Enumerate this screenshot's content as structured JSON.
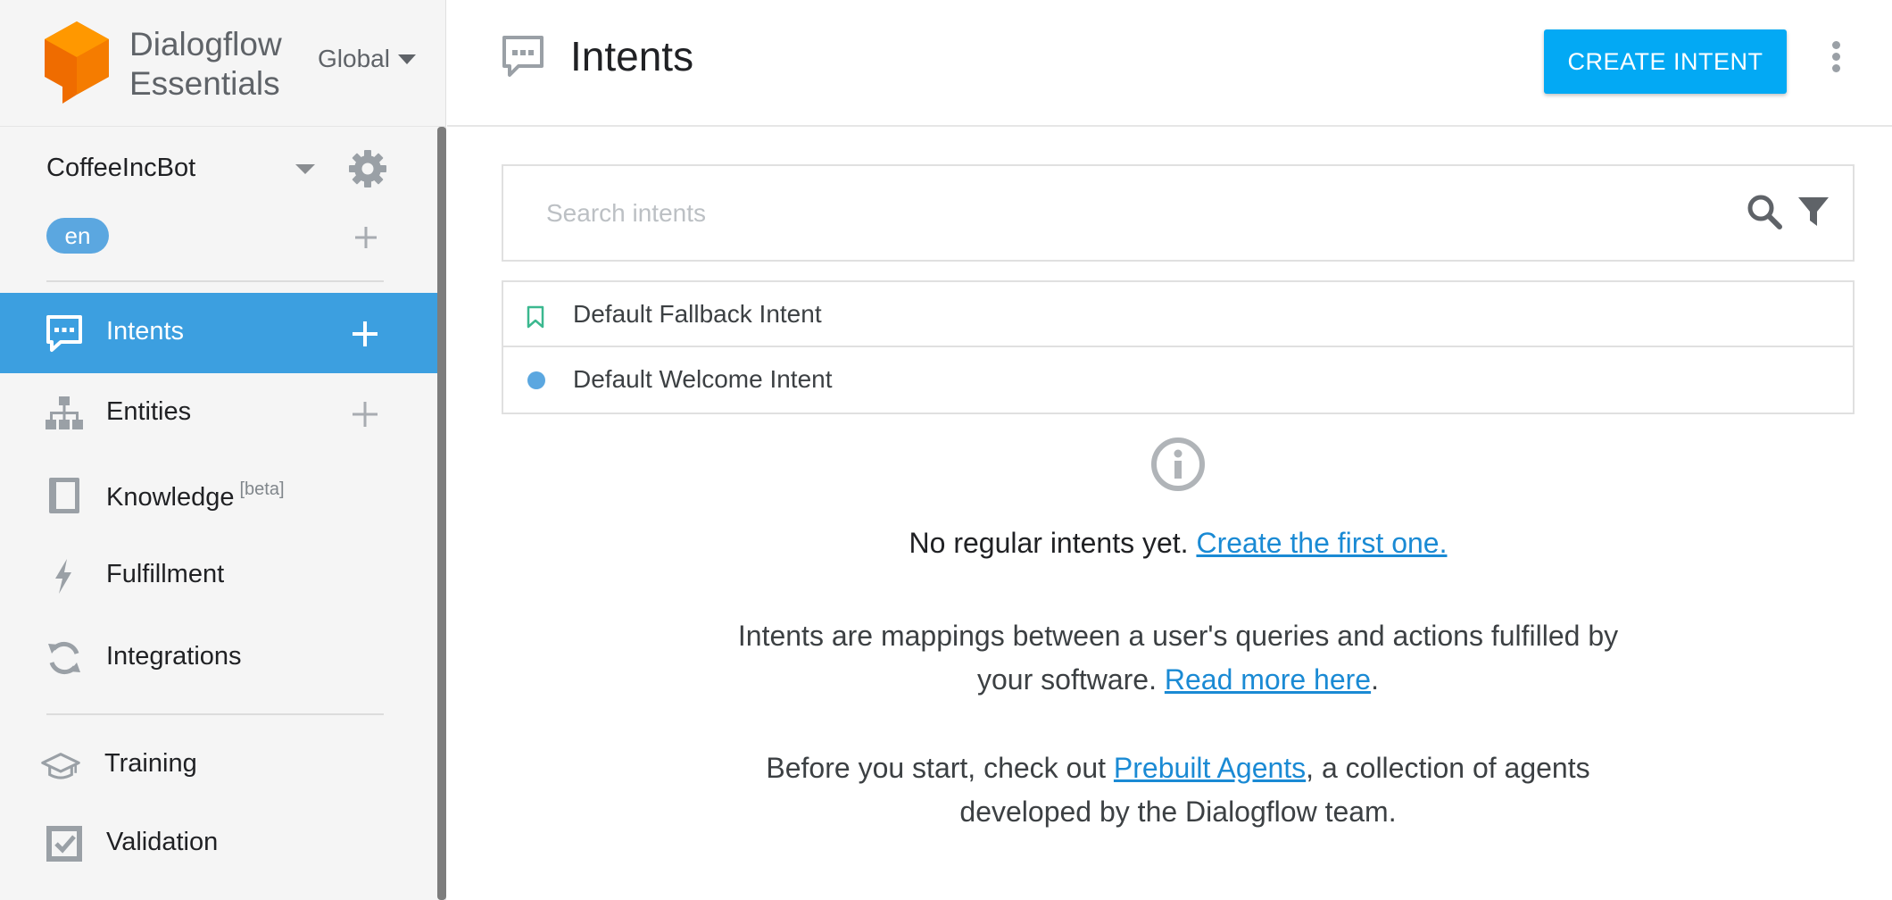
{
  "brand": {
    "name_line1": "Dialogflow",
    "name_line2": "Essentials",
    "region": "Global"
  },
  "agent": {
    "name": "CoffeeIncBot",
    "language": "en"
  },
  "sidebar": {
    "items": [
      {
        "label": "Intents",
        "icon": "chat-icon",
        "active": true
      },
      {
        "label": "Entities",
        "icon": "hierarchy-icon"
      },
      {
        "label": "Knowledge",
        "badge": "[beta]",
        "icon": "book-icon"
      },
      {
        "label": "Fulfillment",
        "icon": "lightning-icon"
      },
      {
        "label": "Integrations",
        "icon": "refresh-icon"
      },
      {
        "label": "Training",
        "icon": "graduation-cap-icon"
      },
      {
        "label": "Validation",
        "icon": "checkbox-icon"
      }
    ]
  },
  "header": {
    "title": "Intents",
    "create_label": "CREATE INTENT"
  },
  "search": {
    "placeholder": "Search intents"
  },
  "intents": [
    {
      "name": "Default Fallback Intent",
      "icon": "bookmark-icon"
    },
    {
      "name": "Default Welcome Intent",
      "icon": "dot-icon"
    }
  ],
  "empty_state": {
    "message": "No regular intents yet.",
    "link": "Create the first one.",
    "desc_line1": "Intents are mappings between a user's queries and actions fulfilled by",
    "desc_line2_pre": "your software.",
    "desc_link": "Read more here",
    "desc_line2_post": ".",
    "prebuilt_pre": "Before you start, check out",
    "prebuilt_link": "Prebuilt Agents",
    "prebuilt_post": ", a collection of agents",
    "prebuilt_line2": "developed by the Dialogflow team."
  },
  "colors": {
    "accent": "#03a9f4",
    "active_nav": "#3c9fe0",
    "link": "#1a8ad4",
    "logo_orange": "#ef6c00"
  }
}
